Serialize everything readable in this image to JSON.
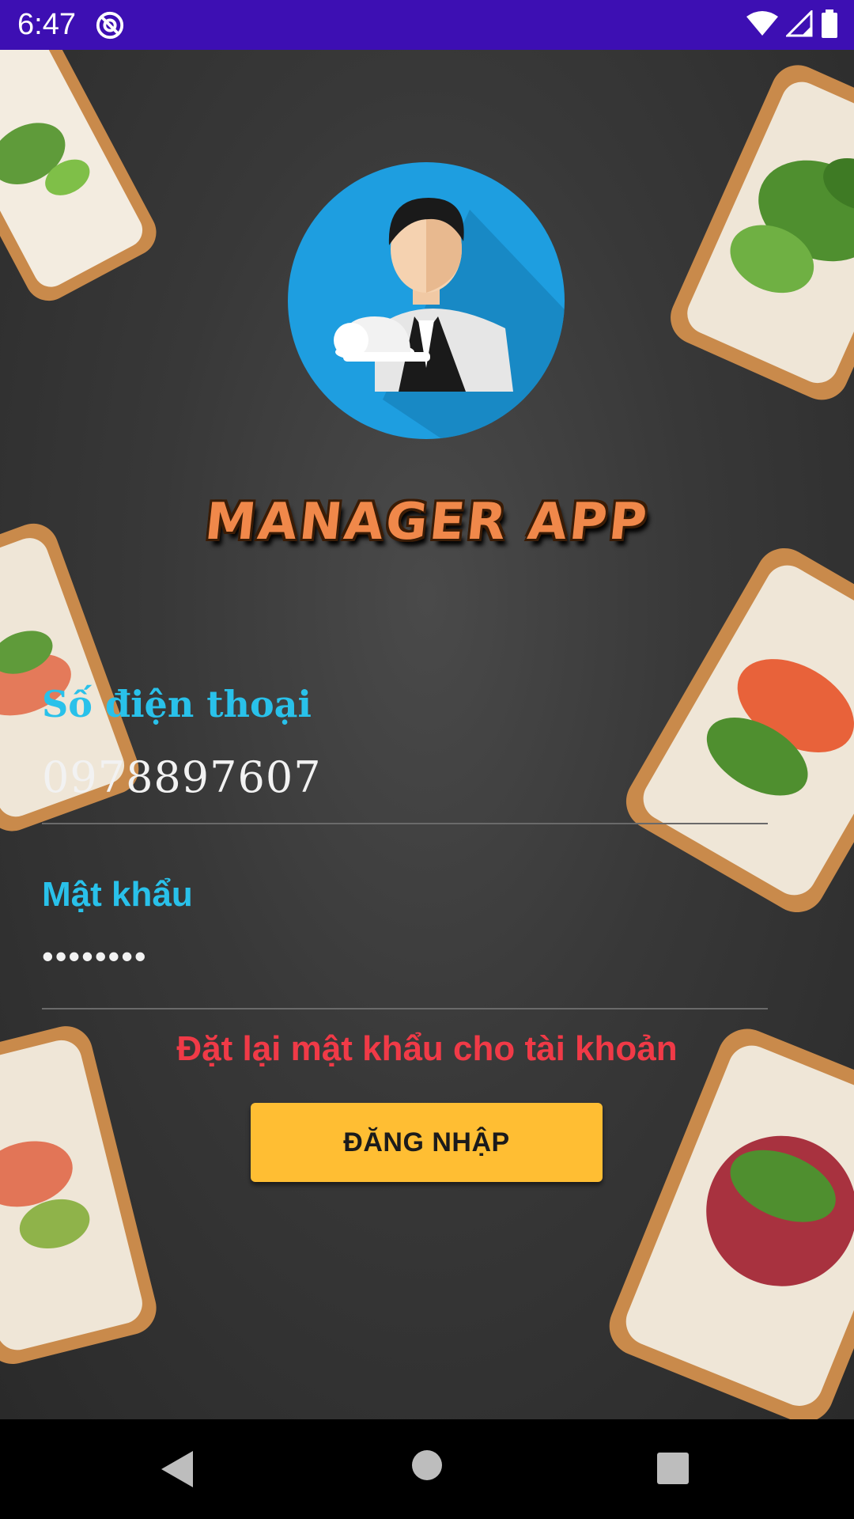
{
  "status_bar": {
    "time": "6:47",
    "background_color": "#3d0fb3",
    "icons": [
      "at-sign-icon",
      "wifi-icon",
      "signal-icon",
      "battery-icon"
    ]
  },
  "header": {
    "avatar_icon": "waiter-avatar-icon",
    "app_title": "MANAGER APP"
  },
  "login_form": {
    "phone_label": "Số điện thoại",
    "phone_value": "0978897607",
    "password_label": "Mật khẩu",
    "password_value": "••••••••",
    "reset_password_link": "Đặt lại mật khẩu cho tài khoản",
    "login_button": "ĐĂNG NHẬP"
  },
  "colors": {
    "label": "#29c1ea",
    "link": "#f03a47",
    "button": "#ffbe33",
    "title": "#f0884a"
  },
  "nav_bar": {
    "icons": [
      "back-triangle-icon",
      "home-circle-icon",
      "recents-square-icon"
    ]
  }
}
